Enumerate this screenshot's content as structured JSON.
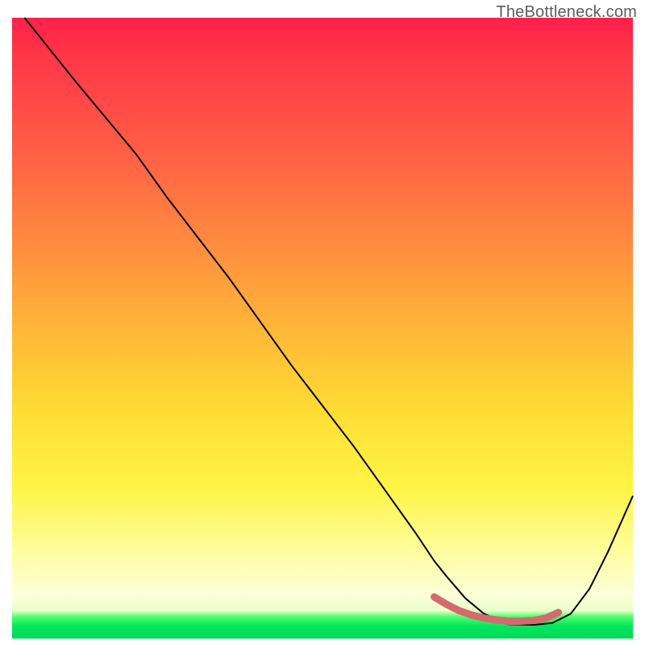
{
  "watermark": "TheBottleneck.com",
  "chart_data": {
    "type": "line",
    "title": "",
    "xlabel": "",
    "ylabel": "",
    "xlim": [
      0,
      100
    ],
    "ylim": [
      0,
      100
    ],
    "series": [
      {
        "name": "curve",
        "color": "#000000",
        "x": [
          2,
          6,
          10,
          15,
          20,
          25,
          30,
          35,
          40,
          45,
          50,
          55,
          60,
          65,
          68,
          70,
          73,
          76,
          80,
          84,
          87,
          90,
          93,
          96,
          100
        ],
        "y": [
          100,
          95,
          90,
          84,
          78,
          71,
          64.5,
          58,
          51,
          44,
          37.5,
          31,
          24,
          17,
          12.5,
          10,
          6.5,
          4,
          2.3,
          2.2,
          2.5,
          4,
          8,
          14,
          23
        ]
      }
    ],
    "highlight": {
      "color": "#d46a6f",
      "x": [
        68,
        70,
        72,
        74,
        76,
        78,
        80,
        82,
        84,
        86,
        88
      ],
      "y": [
        6.7,
        5.5,
        4.5,
        3.8,
        3.3,
        3.0,
        2.8,
        2.8,
        2.9,
        3.3,
        4.2
      ]
    },
    "gradient_stops": [
      {
        "pos": 0,
        "color": "#ff1f49"
      },
      {
        "pos": 0.2,
        "color": "#ff5a46"
      },
      {
        "pos": 0.5,
        "color": "#ffb638"
      },
      {
        "pos": 0.76,
        "color": "#fff546"
      },
      {
        "pos": 0.93,
        "color": "#fcffd9"
      },
      {
        "pos": 0.97,
        "color": "#4cff6a"
      },
      {
        "pos": 1.0,
        "color": "#00d85a"
      }
    ]
  }
}
